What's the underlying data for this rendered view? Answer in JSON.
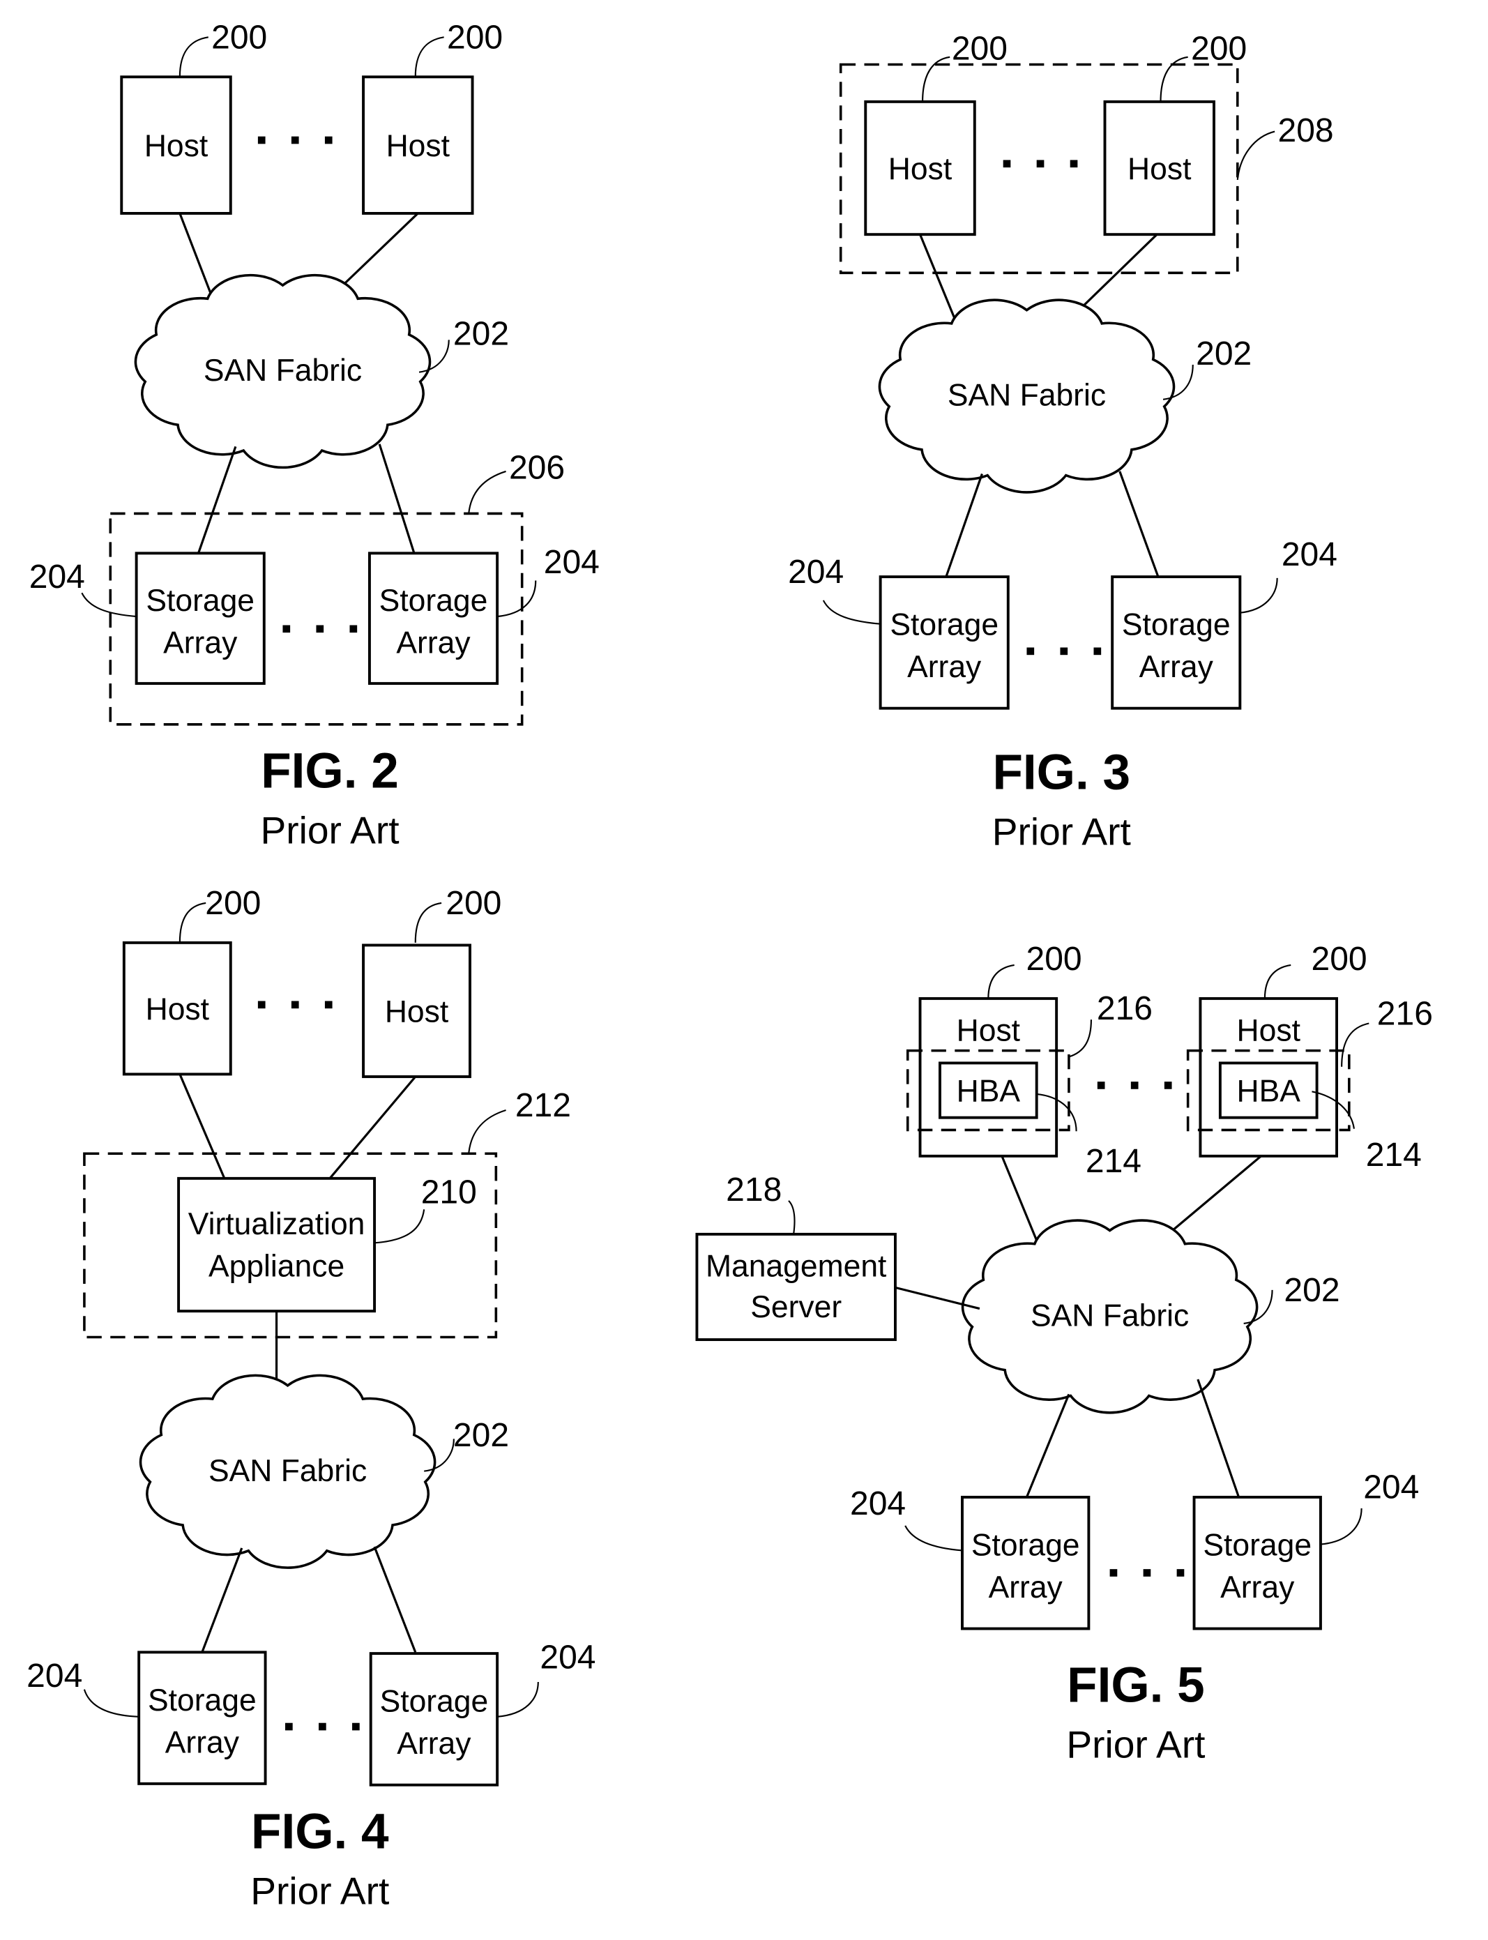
{
  "page": {
    "type": "patent drawing sheet",
    "background": "#ffffff",
    "ink": "#000000"
  },
  "labels": {
    "host": "Host",
    "san_fabric": "SAN Fabric",
    "storage_line1": "Storage",
    "storage_line2": "Array",
    "hba": "HBA",
    "virt_line1": "Virtualization",
    "virt_line2": "Appliance",
    "mgmt_line1": "Management",
    "mgmt_line2": "Server",
    "ellipsis": "· · ·"
  },
  "figures": [
    {
      "id": "fig2",
      "title": "FIG. 2",
      "subtitle": "Prior Art",
      "refs": {
        "host_left": "200",
        "host_right": "200",
        "fabric": "202",
        "storage_left": "204",
        "storage_right": "204",
        "storage_group": "206"
      }
    },
    {
      "id": "fig3",
      "title": "FIG. 3",
      "subtitle": "Prior Art",
      "refs": {
        "host_left": "200",
        "host_right": "200",
        "host_group": "208",
        "fabric": "202",
        "storage_left": "204",
        "storage_right": "204"
      }
    },
    {
      "id": "fig4",
      "title": "FIG. 4",
      "subtitle": "Prior Art",
      "refs": {
        "host_left": "200",
        "host_right": "200",
        "appliance_group": "212",
        "appliance": "210",
        "fabric": "202",
        "storage_left": "204",
        "storage_right": "204"
      }
    },
    {
      "id": "fig5",
      "title": "FIG. 5",
      "subtitle": "Prior Art",
      "refs": {
        "host_left": "200",
        "host_right": "200",
        "hba_group_left": "216",
        "hba_group_right": "216",
        "hba_left": "214",
        "hba_right": "214",
        "mgmt": "218",
        "fabric": "202",
        "storage_left": "204",
        "storage_right": "204"
      }
    }
  ]
}
